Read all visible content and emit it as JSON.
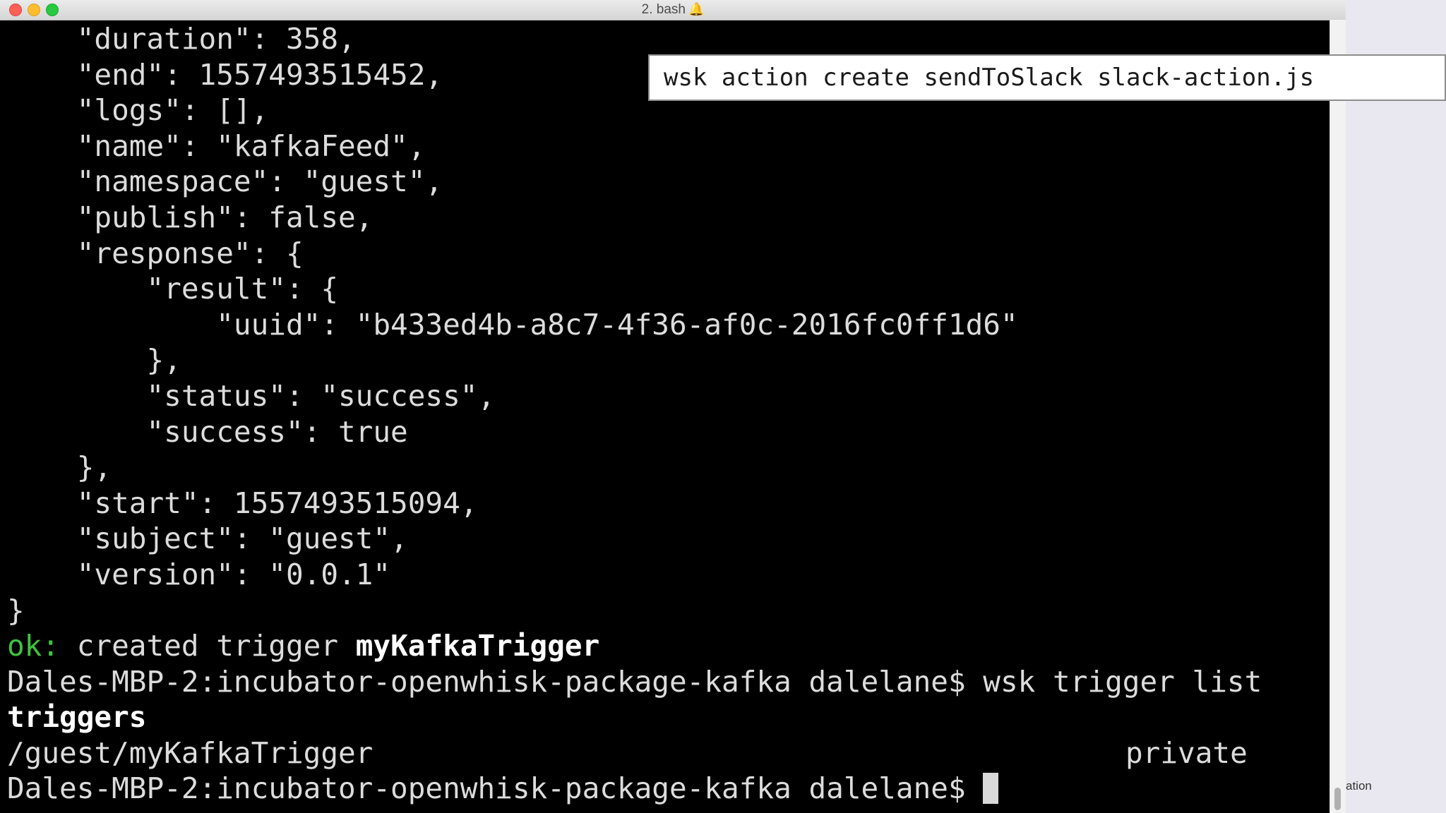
{
  "window": {
    "title": "2. bash",
    "title_icon": "bell-icon"
  },
  "terminal": {
    "lines": [
      "    \"duration\": 358,",
      "    \"end\": 1557493515452,",
      "    \"logs\": [],",
      "    \"name\": \"kafkaFeed\",",
      "    \"namespace\": \"guest\",",
      "    \"publish\": false,",
      "    \"response\": {",
      "        \"result\": {",
      "            \"uuid\": \"b433ed4b-a8c7-4f36-af0c-2016fc0ff1d6\"",
      "        },",
      "        \"status\": \"success\",",
      "        \"success\": true",
      "    },",
      "    \"start\": 1557493515094,",
      "    \"subject\": \"guest\",",
      "    \"version\": \"0.0.1\"",
      "}"
    ],
    "ok_label": "ok:",
    "ok_text": " created trigger ",
    "ok_trigger": "myKafkaTrigger",
    "prompt": "Dales-MBP-2:incubator-openwhisk-package-kafka dalelane$",
    "command_1": " wsk trigger list",
    "triggers_heading": "triggers",
    "trigger_name": "/guest/myKafkaTrigger",
    "trigger_visibility": "private"
  },
  "overlay": {
    "command": "wsk action create sendToSlack slack-action.js"
  },
  "side": {
    "partial_text": "ation"
  },
  "colors": {
    "ok_green": "#3ec43e",
    "terminal_bg": "#000000",
    "terminal_fg": "#dcdcdc"
  }
}
